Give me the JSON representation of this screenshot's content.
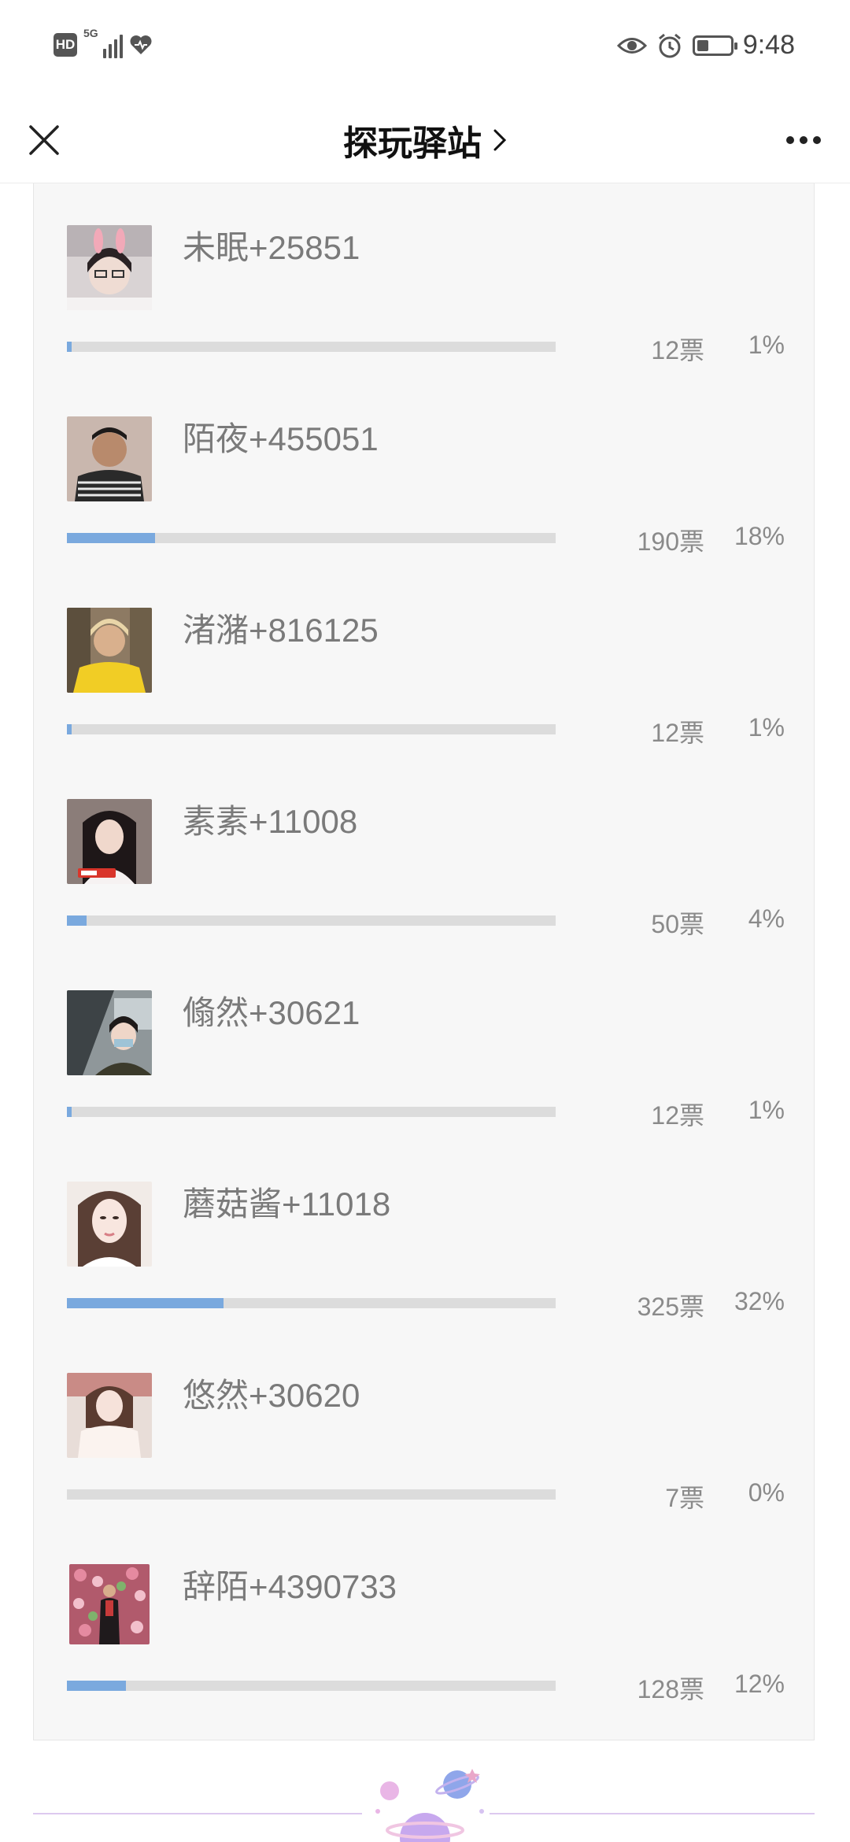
{
  "status_bar": {
    "hd": "HD",
    "network": "5G",
    "time": "9:48",
    "icons": [
      "eye-icon",
      "alarm-icon",
      "battery-icon"
    ]
  },
  "header": {
    "title": "探玩驿站",
    "title_chevron": "›"
  },
  "entries": [
    {
      "name": "未眠+25851",
      "votes": "12票",
      "percent": "1%",
      "fraction": 0.01,
      "avatar_color": "#c9c4c6"
    },
    {
      "name": "陌夜+455051",
      "votes": "190票",
      "percent": "18%",
      "fraction": 0.18,
      "avatar_color": "#5b4f48"
    },
    {
      "name": "渚潴+816125",
      "votes": "12票",
      "percent": "1%",
      "fraction": 0.01,
      "avatar_color": "#d8b54a"
    },
    {
      "name": "素素+11008",
      "votes": "50票",
      "percent": "4%",
      "fraction": 0.04,
      "avatar_color": "#6b5b57"
    },
    {
      "name": "翛然+30621",
      "votes": "12票",
      "percent": "1%",
      "fraction": 0.01,
      "avatar_color": "#6b7275"
    },
    {
      "name": "蘑菇酱+11018",
      "votes": "325票",
      "percent": "32%",
      "fraction": 0.32,
      "avatar_color": "#e4d7d1"
    },
    {
      "name": "悠然+30620",
      "votes": "7票",
      "percent": "0%",
      "fraction": 0.0,
      "avatar_color": "#e8dcd6"
    },
    {
      "name": "辞陌+4390733",
      "votes": "128票",
      "percent": "12%",
      "fraction": 0.12,
      "avatar_color": "#a7566a"
    }
  ],
  "colors": {
    "bar_fill": "#7aa9de",
    "bar_track": "#dcdcdc",
    "card_bg": "#f7f7f7",
    "text_muted": "#8a8a8a"
  }
}
